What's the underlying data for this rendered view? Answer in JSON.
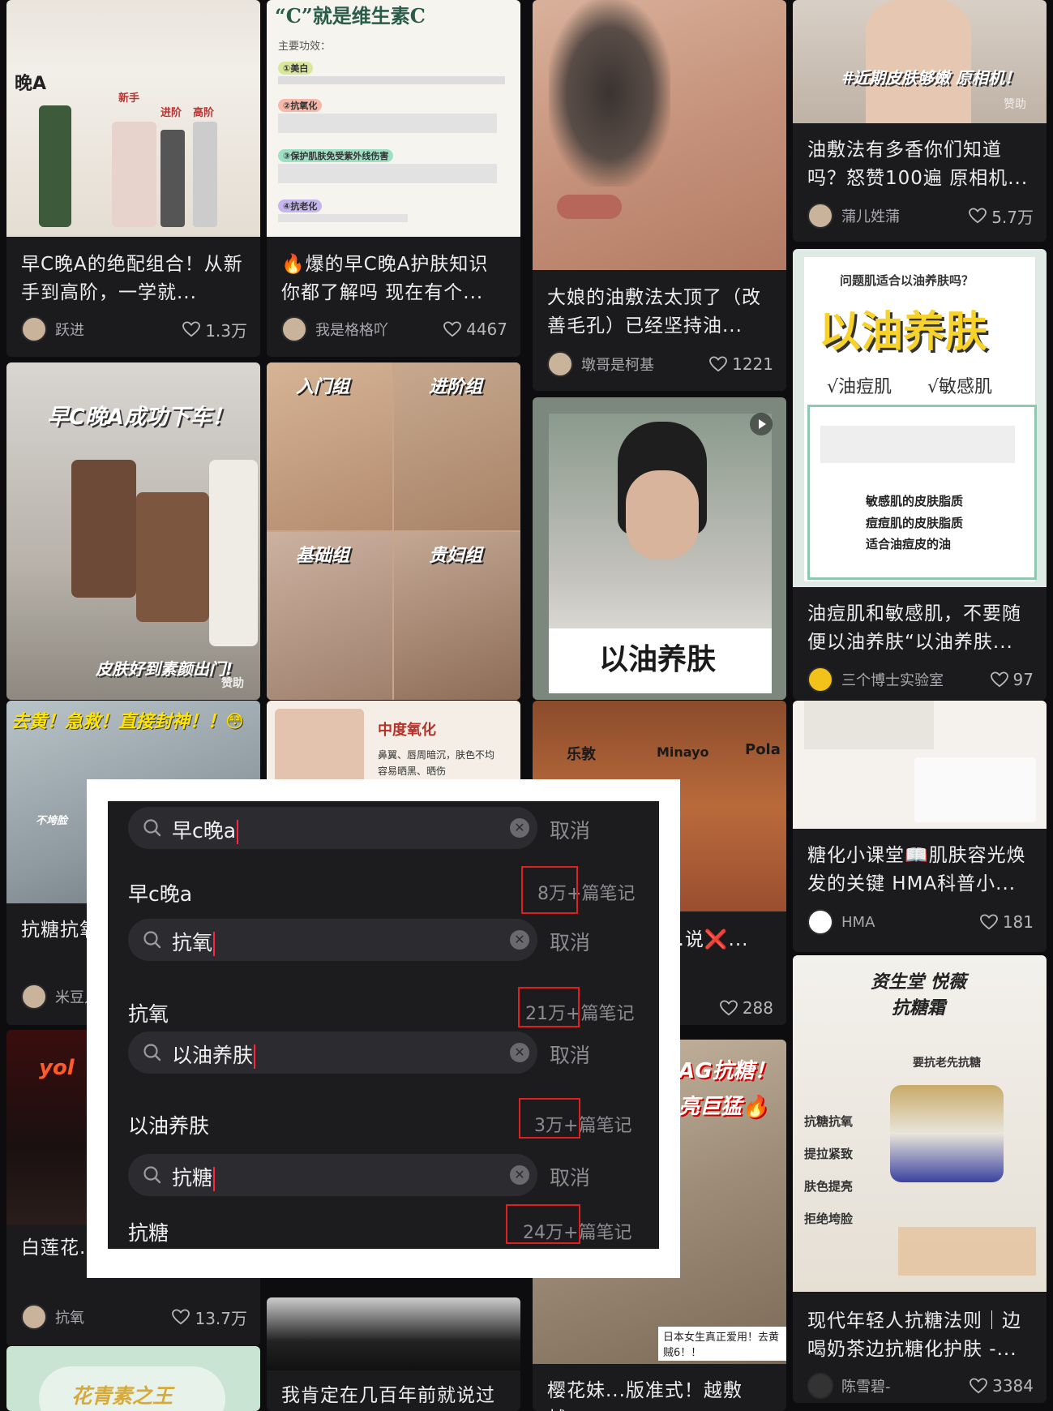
{
  "feed": {
    "cards": [
      {
        "title": "早C晚A的绝配组合！从新手到高阶，一学就...",
        "author": "跃进",
        "likes": "1.3万",
        "img_text": "晚A",
        "img_subs": [
          "新手",
          "进阶",
          "高阶"
        ]
      },
      {
        "title": "🔥爆的早C晚A护肤知识你都了解吗 现在有个...",
        "author": "我是格格吖",
        "likes": "4467",
        "img_text": "“C”就是维生素C",
        "img_subs": [
          "主要功效：",
          "①美白",
          "②抗氧化",
          "③保护肌肤免受紫外线伤害",
          "④抗老化"
        ]
      },
      {
        "title": "大娘的油敷法太顶了（改善毛孔）已经坚持油...",
        "author": "墩哥是柯基",
        "likes": "1221",
        "img_text": ""
      },
      {
        "title": "油敷法有多香你们知道吗？怒赞100遍 原相机...",
        "author": "蒲儿姓蒲",
        "likes": "5.7万",
        "img_text": "#近期皮肤够嫩 原相机！",
        "img_subs": [
          "赞助"
        ]
      },
      {
        "title": "",
        "author": "",
        "likes": "",
        "img_text": "早C晚A成功下车！",
        "img_subs": [
          "皮肤好到素颜出门!",
          "赞助"
        ]
      },
      {
        "title": "",
        "author": "",
        "likes": "",
        "img_text": "入门组",
        "img_subs": [
          "进阶组",
          "基础组",
          "贵妇组"
        ]
      },
      {
        "title": "",
        "author": "",
        "likes": "",
        "img_text": "以油养肤"
      },
      {
        "title": "油痘肌和敏感肌，不要随便以油养肤“以油养肤...",
        "author": "三个博士实验室",
        "likes": "97",
        "img_text": "以油养肤",
        "img_subs": [
          "问题肌适合以油养肤吗？",
          "√油痘肌",
          "√敏感肌",
          "敏感肌的皮肤脂质",
          "痘痘肌的皮肤脂质",
          "适合油痘皮的油"
        ]
      },
      {
        "title": "抗糖抗氧...呼好家伙",
        "author": "米豆儿",
        "likes": "",
        "img_text": "去黄！急救！直接封神！！😳",
        "img_subs": [
          "不垮脸"
        ]
      },
      {
        "title": "",
        "author": "",
        "likes": "",
        "img_text": "中度氧化",
        "img_subs": [
          "鼻翼、唇周暗沉，肤色不均",
          "容易晒黑、晒伤"
        ]
      },
      {
        "title": "...美容钱也省...说❌...",
        "author": "",
        "likes": "288",
        "img_text": "乐敦",
        "img_subs": [
          "Minayo",
          "Pola"
        ]
      },
      {
        "title": "糖化小课堂📖肌肤容光焕发的关键 HMA科普小...",
        "author": "HMA",
        "likes": "181",
        "img_text": ""
      },
      {
        "title": "白莲花...拉满纯欲...",
        "author": "抗氧",
        "likes": "13.7万",
        "img_text": "yol"
      },
      {
        "title": "",
        "author": "",
        "likes": "",
        "img_text": "AG抗糖！",
        "img_subs": [
          "亮巨猛🔥"
        ]
      },
      {
        "title": "现代年轻人抗糖法则｜边喝奶茶边抗糖化护肤 -...",
        "author": "陈雪碧-",
        "likes": "3384",
        "img_text": "资生堂 悦薇抗糖霜",
        "img_subs": [
          "要抗老先抗糖",
          "抗糖抗氧",
          "提拉紧致",
          "肤色提亮",
          "拒绝垮脸"
        ]
      },
      {
        "title": "",
        "author": "",
        "likes": "",
        "img_text": "花青素之王"
      },
      {
        "title": "我肯定在几百年前就说过",
        "author": "",
        "likes": "",
        "img_text": ""
      },
      {
        "title": "樱花妹...版准式！越敷越...",
        "author": "",
        "likes": "",
        "img_text": "日本女生真正爱用！去黄贼6！！"
      }
    ]
  },
  "overlay": {
    "cancel_label": "取消",
    "notes_suffix": "篇笔记",
    "searches": [
      {
        "query": "早c晚a",
        "result_term": "早c晚a",
        "count": "8万+"
      },
      {
        "query": "抗氧",
        "result_term": "抗氧",
        "count": "21万+"
      },
      {
        "query": "以油养肤",
        "result_term": "以油养肤",
        "count": "3万+"
      },
      {
        "query": "抗糖",
        "result_term": "抗糖",
        "count": "24万+"
      }
    ]
  }
}
